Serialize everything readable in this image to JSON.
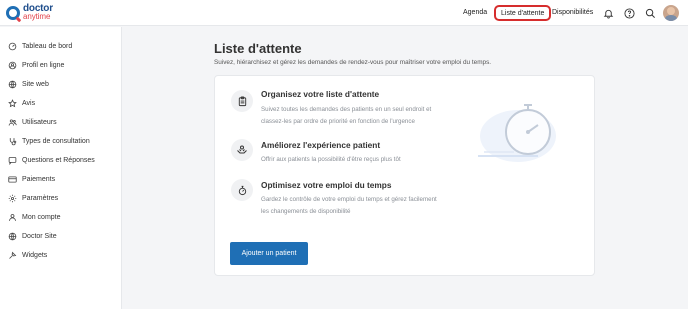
{
  "brand": {
    "line1": "doctor",
    "line2": "anytime"
  },
  "topnav": {
    "agenda": "Agenda",
    "waiting_list": "Liste d'attente",
    "availability": "Disponibilités"
  },
  "sidebar": {
    "items": [
      {
        "label": "Tableau de bord",
        "icon": "dashboard-icon"
      },
      {
        "label": "Profil en ligne",
        "icon": "user-icon"
      },
      {
        "label": "Site web",
        "icon": "globe-icon"
      },
      {
        "label": "Avis",
        "icon": "star-icon"
      },
      {
        "label": "Utilisateurs",
        "icon": "users-icon"
      },
      {
        "label": "Types de consultation",
        "icon": "stethoscope-icon"
      },
      {
        "label": "Questions et Réponses",
        "icon": "chat-icon"
      },
      {
        "label": "Paiements",
        "icon": "card-icon"
      },
      {
        "label": "Paramètres",
        "icon": "gear-icon"
      },
      {
        "label": "Mon compte",
        "icon": "account-icon"
      },
      {
        "label": "Doctor Site",
        "icon": "globe-icon"
      },
      {
        "label": "Widgets",
        "icon": "widget-icon"
      }
    ]
  },
  "main": {
    "title": "Liste d'attente",
    "subtitle": "Suivez, hiérarchisez et gérez les demandes de rendez-vous pour maîtriser votre emploi du temps.",
    "features": [
      {
        "title": "Organisez votre liste d'attente",
        "desc1": "Suivez toutes les demandes des patients en un seul endroit et",
        "desc2": "classez-les par ordre de priorité en fonction de l'urgence"
      },
      {
        "title": "Améliorez l'expérience patient",
        "desc1": "Offrir aux patients la possibilité d'être reçus plus tôt",
        "desc2": ""
      },
      {
        "title": "Optimisez votre emploi du temps",
        "desc1": "Gardez le contrôle de votre emploi du temps et gérez facilement",
        "desc2": "les changements de disponibilité"
      }
    ],
    "cta": "Ajouter un patient"
  },
  "colors": {
    "accent": "#1f6fb5",
    "highlight": "#d62d2d",
    "brand_red": "#e2434b"
  }
}
